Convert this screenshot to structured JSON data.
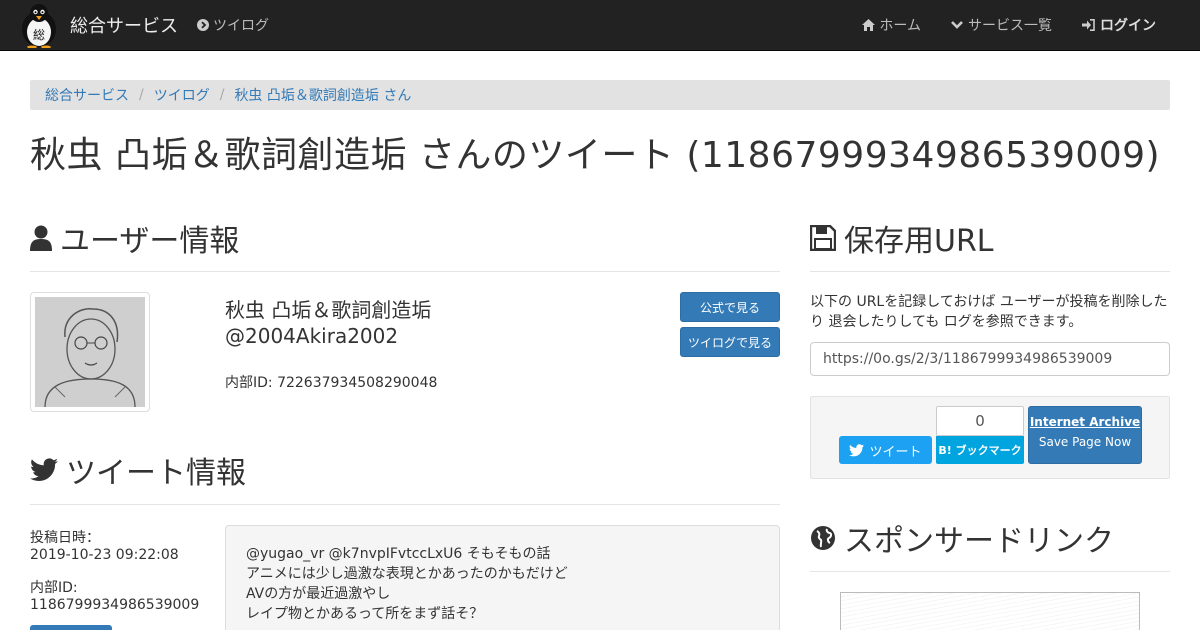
{
  "navbar": {
    "brand": "総合サービス",
    "logo_char": "総",
    "twilog": "ツイログ",
    "home": "ホーム",
    "services": "サービス一覧",
    "login": "ログイン"
  },
  "breadcrumb": [
    "総合サービス",
    "ツイログ",
    "秋虫 凸垢＆歌詞創造垢 さん"
  ],
  "page_title": "秋虫 凸垢＆歌詞創造垢 さんのツイート (1186799934986539009)",
  "user_section": {
    "heading": "ユーザー情報",
    "name": "秋虫 凸垢＆歌詞創造垢",
    "screen_name": "@2004Akira2002",
    "internal_id": "内部ID: 722637934508290048",
    "official_button": "公式で見る",
    "twilog_button": "ツイログで見る"
  },
  "tweet_section": {
    "heading": "ツイート情報",
    "posted_label": "投稿日時：",
    "posted_value": "2019-10-23 09:22:08",
    "id_label": "内部ID:",
    "id_value": "1186799934986539009",
    "lines": [
      "@yugao_vr @k7nvpIFvtccLxU6 そもそもの話",
      "アニメには少し過激な表現とかあったのかもだけど",
      "AVの方が最近過激やし",
      "レイプ物とかあるって所をまず話そ？"
    ]
  },
  "save_section": {
    "heading": "保存用URL",
    "description": "以下の URLを記録しておけば ユーザーが投稿を削除したり 退会したりしても ログを参照できます。",
    "url": "https://0o.gs/2/3/1186799934986539009",
    "tweet_button": "ツイート",
    "hatena_count": "0",
    "hatena_button": "B! ブックマーク",
    "ia_title": "Internet Archive",
    "ia_sub": "Save Page Now"
  },
  "sponsor_section": {
    "heading": "スポンサードリンク"
  },
  "colors": {
    "navbar_bg": "#222222",
    "link": "#337ab7",
    "primary": "#337ab7",
    "twitter": "#1da1f2",
    "hatena": "#00a4de"
  }
}
